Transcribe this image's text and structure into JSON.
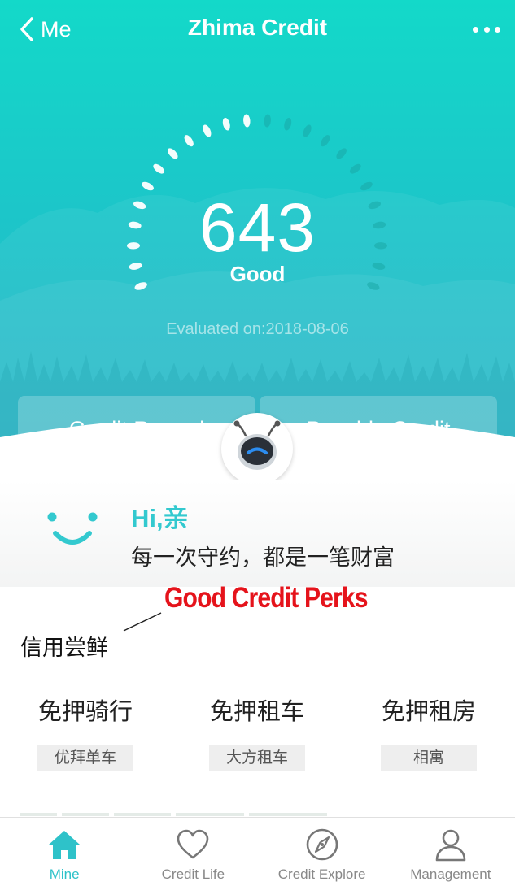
{
  "nav": {
    "back_label": "Me",
    "title": "Zhima Credit"
  },
  "score": {
    "value": "643",
    "level": "Good",
    "evaluated": "Evaluated on:2018-08-06"
  },
  "cards": {
    "left_label": "Credit Record",
    "right_label": "Payable Credit"
  },
  "greeting": {
    "hi": "Hi,亲",
    "message": "每一次守约，都是一笔财富"
  },
  "annotation": {
    "title": "Good Credit Perks",
    "label": "信用尝鲜"
  },
  "perks": [
    {
      "title": "免押骑行",
      "tag": "优拜单车"
    },
    {
      "title": "免押租车",
      "tag": "大方租车"
    },
    {
      "title": "免押租房",
      "tag": "相寓"
    }
  ],
  "tabs": [
    {
      "label": "Mine",
      "icon": "home-icon",
      "active": true
    },
    {
      "label": "Credit Life",
      "icon": "heart-icon",
      "active": false
    },
    {
      "label": "Credit Explore",
      "icon": "compass-icon",
      "active": false
    },
    {
      "label": "Management",
      "icon": "person-icon",
      "active": false
    }
  ],
  "colors": {
    "accent": "#2ec2c9",
    "hero_top": "#13d9c9",
    "hero_bottom": "#27b3c6",
    "annotation_red": "#e5131b"
  }
}
